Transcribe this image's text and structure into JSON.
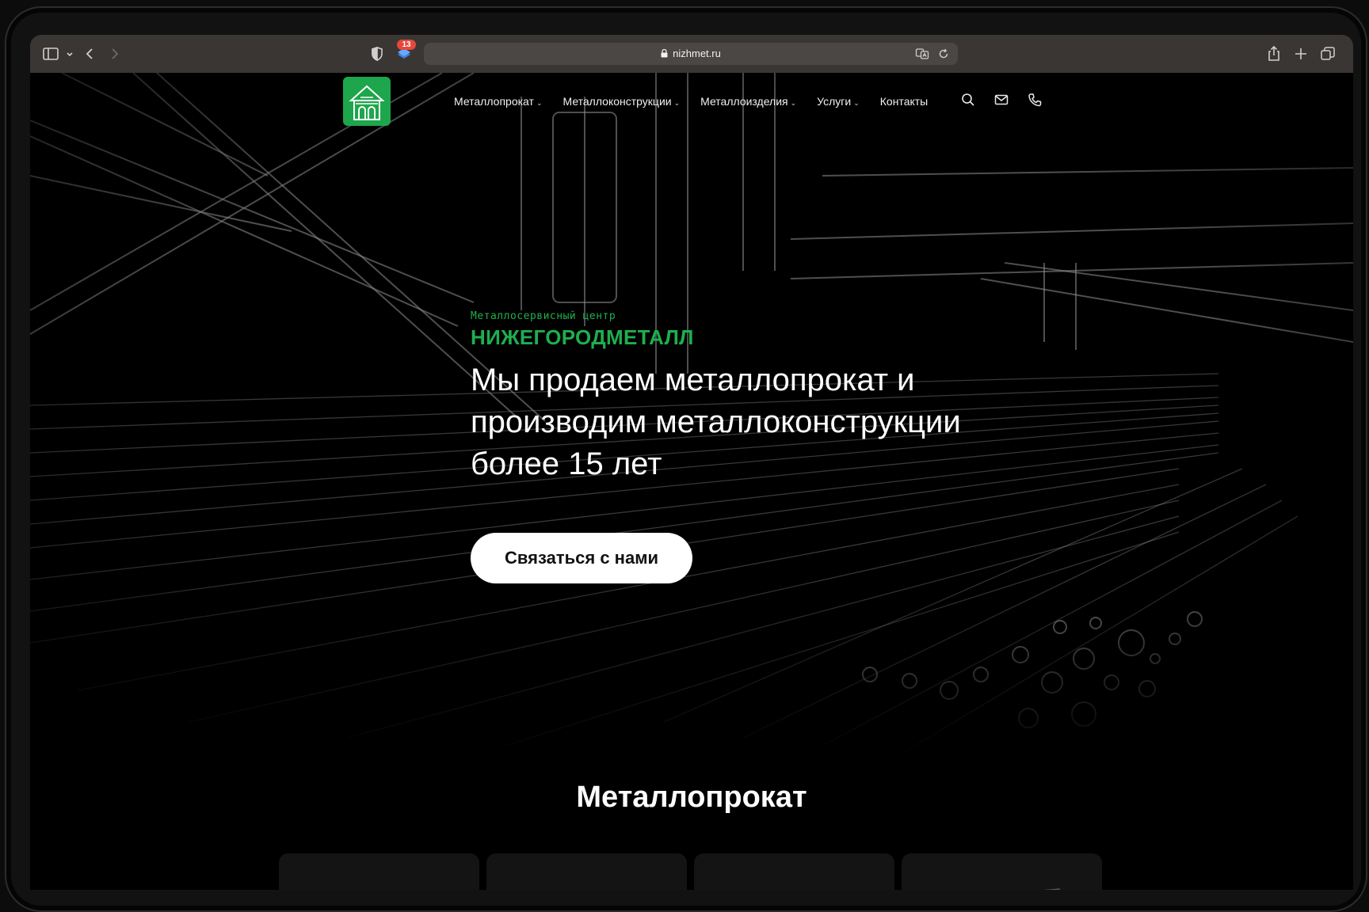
{
  "browser": {
    "url": "nizhmet.ru",
    "extension_badge_count": "13"
  },
  "site": {
    "nav": [
      {
        "label": "Металлопрокат",
        "has_dropdown": true
      },
      {
        "label": "Металлоконструкции",
        "has_dropdown": true
      },
      {
        "label": "Металлоизделия",
        "has_dropdown": true
      },
      {
        "label": "Услуги",
        "has_dropdown": true
      },
      {
        "label": "Контакты",
        "has_dropdown": false
      }
    ],
    "nav_icons": [
      "search-icon",
      "mail-icon",
      "phone-icon"
    ],
    "accent_color": "#1fae4e"
  },
  "hero": {
    "kicker": "Металлосервисный центр",
    "brand": "НИЖЕГОРОДМЕТАЛЛ",
    "headline_lines": [
      "Мы продаем металлопрокат и",
      "производим металлоконструкции",
      "более 15 лет"
    ],
    "cta_label": "Связаться с нами"
  },
  "section": {
    "title": "Металлопрокат",
    "card_count": 4
  }
}
